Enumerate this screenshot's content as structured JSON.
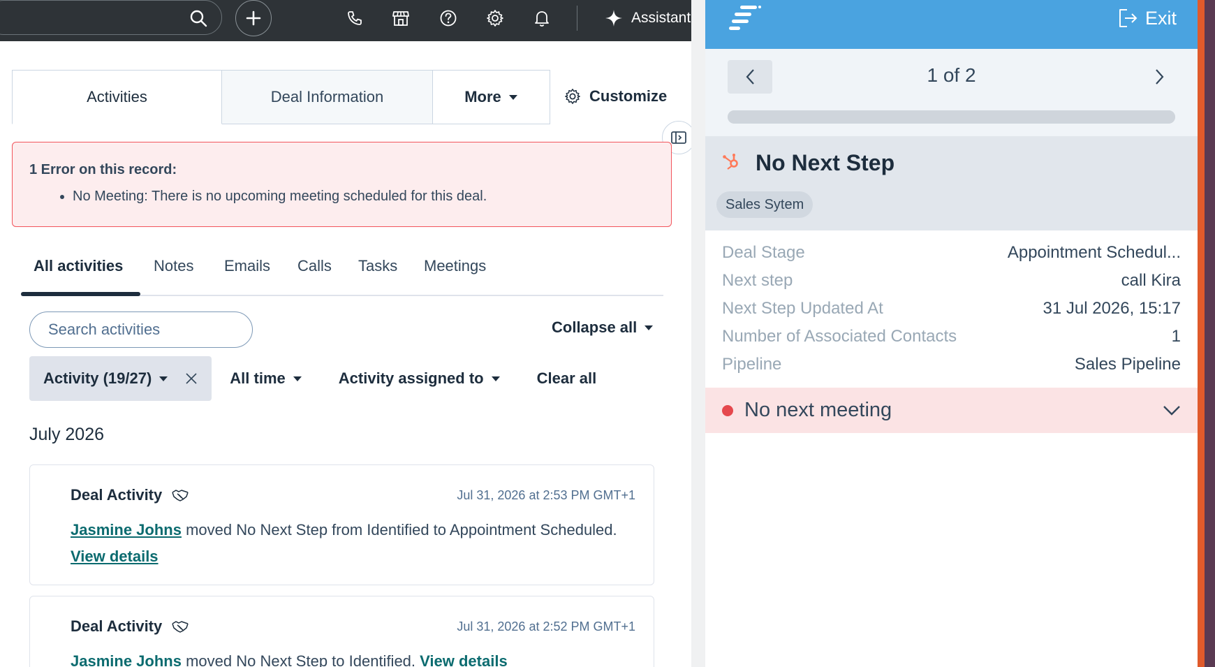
{
  "topbar": {
    "assistant_label": "Assistant",
    "icons": [
      "search-icon",
      "plus-icon",
      "phone-icon",
      "marketplace-icon",
      "help-icon",
      "gear-icon",
      "bell-icon",
      "sparkle-icon"
    ]
  },
  "record_tabs": {
    "activities": "Activities",
    "deal_information": "Deal Information",
    "more": "More",
    "customize": "Customize"
  },
  "error": {
    "title": "1 Error on this record:",
    "items": [
      "No Meeting: There is no upcoming meeting scheduled for this deal."
    ]
  },
  "activity_tabs": [
    "All activities",
    "Notes",
    "Emails",
    "Calls",
    "Tasks",
    "Meetings"
  ],
  "search": {
    "placeholder": "Search activities"
  },
  "collapse_all": "Collapse all",
  "filters": {
    "activity_chip": "Activity (19/27)",
    "all_time": "All time",
    "assigned_to": "Activity assigned to",
    "clear_all": "Clear all"
  },
  "month_header": "July 2026",
  "activities": [
    {
      "title": "Deal Activity",
      "time": "Jul 31, 2026 at 2:53 PM GMT+1",
      "actor": "Jasmine Johns",
      "text": " moved No Next Step from Identified to Appointment Scheduled. ",
      "link": "View details"
    },
    {
      "title": "Deal Activity",
      "time": "Jul 31, 2026 at 2:52 PM GMT+1",
      "actor": "Jasmine Johns",
      "text": " moved No Next Step to Identified. ",
      "link": "View details"
    }
  ],
  "panel": {
    "exit_label": "Exit",
    "counter": "1 of 2",
    "record_title": "No Next Step",
    "tag": "Sales Sytem",
    "properties": [
      {
        "key": "Deal Stage",
        "value": "Appointment Schedul..."
      },
      {
        "key": "Next step",
        "value": "call Kira"
      },
      {
        "key": "Next Step Updated At",
        "value": "31 Jul 2026, 15:17"
      },
      {
        "key": "Number of Associated Contacts",
        "value": "1"
      },
      {
        "key": "Pipeline",
        "value": "Sales Pipeline"
      }
    ],
    "meeting_status": "No next meeting"
  },
  "colors": {
    "topbar": "#2e3337",
    "panel_header": "#4aa3e0",
    "error_border": "#f2545b",
    "error_bg": "#fdedee",
    "link": "#0b6b6f",
    "status_dot": "#e5484d"
  }
}
